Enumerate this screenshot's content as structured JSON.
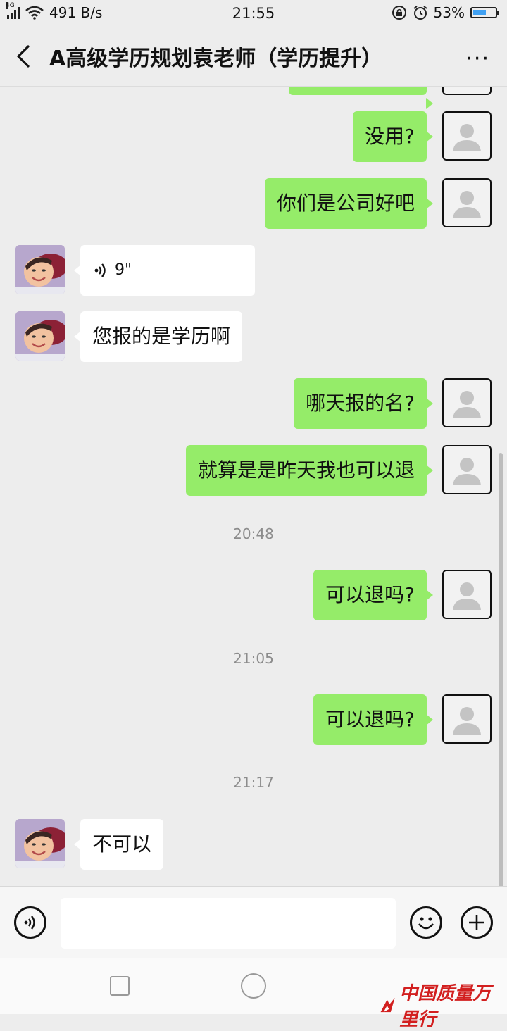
{
  "status": {
    "network": "4G",
    "speed": "491 B/s",
    "time": "21:55",
    "battery": "53%",
    "battery_level": 0.53
  },
  "header": {
    "title": "A高级学历规划袁老师（学历提升）",
    "more": "···"
  },
  "messages": [
    {
      "side": "me",
      "text": "没用?"
    },
    {
      "side": "me",
      "text": "你们是公司好吧"
    },
    {
      "side": "them",
      "type": "voice",
      "text": "9\""
    },
    {
      "side": "them",
      "text": "您报的是学历啊"
    },
    {
      "side": "me",
      "text": "哪天报的名?"
    },
    {
      "side": "me",
      "text": "就算是是昨天我也可以退"
    },
    {
      "type": "time",
      "text": "20:48"
    },
    {
      "side": "me",
      "text": "可以退吗?"
    },
    {
      "type": "time",
      "text": "21:05"
    },
    {
      "side": "me",
      "text": "可以退吗?"
    },
    {
      "type": "time",
      "text": "21:17"
    },
    {
      "side": "them",
      "text": "不可以"
    }
  ],
  "input": {
    "value": "",
    "placeholder": ""
  },
  "watermark": "中国质量万里行",
  "colors": {
    "me_bubble": "#95ec69",
    "them_bubble": "#ffffff",
    "background": "#ededed"
  },
  "icons": [
    "back-arrow-icon",
    "more-dots-icon",
    "voice-icon",
    "emoji-icon",
    "plus-icon"
  ]
}
